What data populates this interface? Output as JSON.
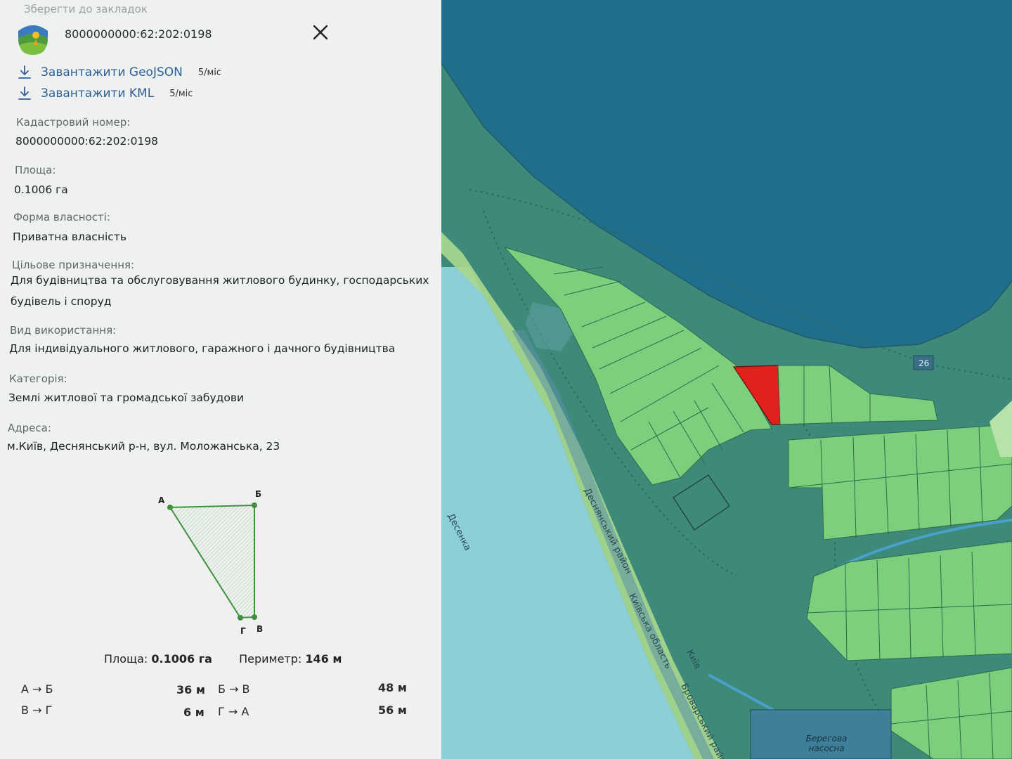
{
  "panel": {
    "top_ghost": "Зберегти до закладок",
    "title": "8000000000:62:202:0198",
    "downloads": [
      {
        "label": "Завантажити GeoJSON",
        "limit": "5/міс"
      },
      {
        "label": "Завантажити KML",
        "limit": "5/міс"
      }
    ],
    "fields": {
      "cadastral_label": "Кадастровий номер:",
      "cadastral_value": "8000000000:62:202:0198",
      "area_label": "Площа:",
      "area_value": "0.1006 га",
      "ownership_label": "Форма власності:",
      "ownership_value": "Приватна власність",
      "purpose_label": "Цільове призначення:",
      "purpose_value": "Для будівництва та обслуговування житлового будинку, господарських будівель і споруд",
      "usage_label": "Вид використання:",
      "usage_value": "Для індивідуального житлового, гаражного і дачного будівництва",
      "category_label": "Категорія:",
      "category_value": "Землі житлової та громадської забудови",
      "address_label": "Адреса:",
      "address_value": "м.Київ, Деснянський р-н, вул. Моложанська, 23"
    },
    "diagram": {
      "vertices": [
        "А",
        "Б",
        "В",
        "Г"
      ],
      "area_label": "Площа:",
      "area_value": "0.1006 га",
      "perimeter_label": "Периметр:",
      "perimeter_value": "146 м",
      "segments": [
        {
          "label": "А → Б",
          "length": "36 м"
        },
        {
          "label": "Б → В",
          "length": "48 м"
        },
        {
          "label": "В → Г",
          "length": "6 м"
        },
        {
          "label": "Г → А",
          "length": "56 м"
        }
      ]
    }
  },
  "map": {
    "labels": {
      "river": "Десенка",
      "district": "Деснянський район",
      "oblast": "Київська область",
      "city": "Київ",
      "brovary": "Броварський район",
      "road_number": "26",
      "station": "Берегова насосна"
    },
    "colors": {
      "water_deep": "#1f6f8c",
      "water_light": "#8ccfd6",
      "land": "#3e8a7a",
      "parcel": "#7ccf7c",
      "selected_parcel": "#e0211c"
    }
  },
  "icons": [
    "app-logo-icon",
    "close-icon",
    "download-icon"
  ]
}
